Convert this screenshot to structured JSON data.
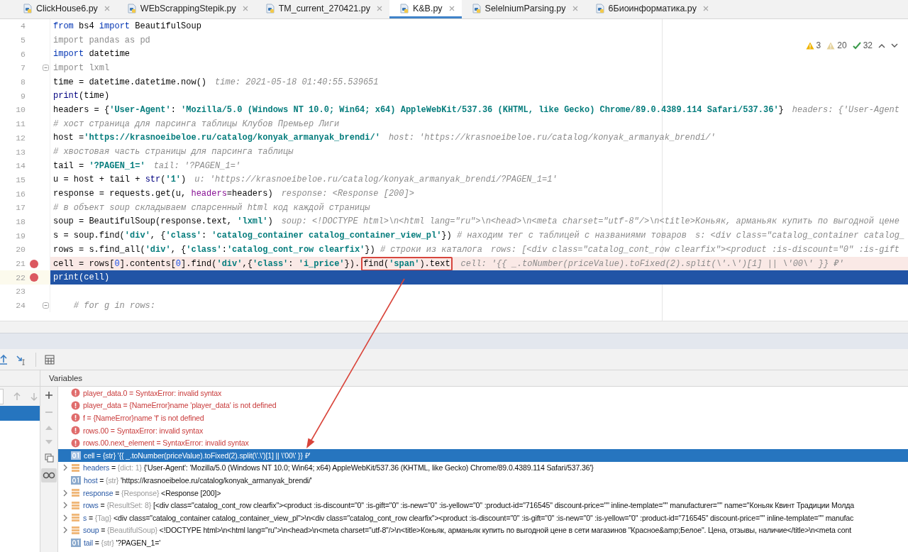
{
  "tabs": [
    {
      "label": "ClickHouse6.py",
      "selected": false
    },
    {
      "label": "WEbScrappingStepik.py",
      "selected": false
    },
    {
      "label": "TM_current_270421.py",
      "selected": false
    },
    {
      "label": "K&B.py",
      "selected": true
    },
    {
      "label": "SelelniumParsing.py",
      "selected": false
    },
    {
      "label": "6Биоинформатика.py",
      "selected": false
    }
  ],
  "inspections": {
    "errors": "3",
    "warnings": "20",
    "passed": "32"
  },
  "editor": {
    "lines": [
      {
        "number": "4",
        "breakpoint": false,
        "kind": "plain",
        "fold": false,
        "tokens": [
          {
            "kind": "keyword",
            "text": "from"
          },
          {
            "kind": "plain",
            "text": " bs4 "
          },
          {
            "kind": "keyword",
            "text": "import"
          },
          {
            "kind": "plain",
            "text": " BeautifulSoup"
          }
        ]
      },
      {
        "number": "5",
        "breakpoint": false,
        "kind": "plain",
        "fold": false,
        "tokens": [
          {
            "kind": "unused",
            "text": "import pandas as pd"
          }
        ]
      },
      {
        "number": "6",
        "breakpoint": false,
        "kind": "plain",
        "fold": false,
        "tokens": [
          {
            "kind": "keyword",
            "text": "import"
          },
          {
            "kind": "plain",
            "text": " datetime"
          }
        ]
      },
      {
        "number": "7",
        "breakpoint": false,
        "kind": "plain",
        "fold": true,
        "tokens": [
          {
            "kind": "unused",
            "text": "import lxml"
          }
        ]
      },
      {
        "number": "8",
        "breakpoint": false,
        "kind": "plain",
        "fold": false,
        "tokens": [
          {
            "kind": "plain",
            "text": "time = datetime.datetime.now()"
          }
        ],
        "hint": "time: 2021-05-18 01:40:55.539651"
      },
      {
        "number": "9",
        "breakpoint": false,
        "kind": "plain",
        "fold": false,
        "tokens": [
          {
            "kind": "builtin",
            "text": "print"
          },
          {
            "kind": "plain",
            "text": "(time)"
          }
        ]
      },
      {
        "number": "10",
        "breakpoint": false,
        "kind": "plain",
        "fold": false,
        "tokens": [
          {
            "kind": "plain",
            "text": "headers = {"
          },
          {
            "kind": "string",
            "text": "'User-Agent'"
          },
          {
            "kind": "plain",
            "text": ": "
          },
          {
            "kind": "string",
            "text": "'Mozilla/5.0 (Windows NT 10.0; Win64; x64) AppleWebKit/537.36 (KHTML, like Gecko) Chrome/89.0.4389.114 Safari/537.36'"
          },
          {
            "kind": "plain",
            "text": "}"
          }
        ],
        "hint": "headers: {'User-Agent"
      },
      {
        "number": "11",
        "breakpoint": false,
        "kind": "plain",
        "fold": false,
        "tokens": [
          {
            "kind": "comment",
            "text": "# хост страница для парсинга таблицы Клубов Премьер Лиги"
          }
        ]
      },
      {
        "number": "12",
        "breakpoint": false,
        "kind": "plain",
        "fold": false,
        "tokens": [
          {
            "kind": "plain",
            "text": "host ="
          },
          {
            "kind": "string",
            "text": "'https://krasnoeibeloe.ru/catalog/konyak_armanyak_brendi/'"
          }
        ],
        "hint": "host: 'https://krasnoeibeloe.ru/catalog/konyak_armanyak_brendi/'"
      },
      {
        "number": "13",
        "breakpoint": false,
        "kind": "plain",
        "fold": false,
        "tokens": [
          {
            "kind": "comment",
            "text": "# хвостовая часть страницы для парсинга таблицы"
          }
        ]
      },
      {
        "number": "14",
        "breakpoint": false,
        "kind": "plain",
        "fold": false,
        "tokens": [
          {
            "kind": "plain",
            "text": "tail = "
          },
          {
            "kind": "string",
            "text": "'?PAGEN_1='"
          }
        ],
        "hint": "tail: '?PAGEN_1='"
      },
      {
        "number": "15",
        "breakpoint": false,
        "kind": "plain",
        "fold": false,
        "tokens": [
          {
            "kind": "plain",
            "text": "u = host + tail + "
          },
          {
            "kind": "builtin",
            "text": "str"
          },
          {
            "kind": "plain",
            "text": "("
          },
          {
            "kind": "string",
            "text": "'1'"
          },
          {
            "kind": "plain",
            "text": ")"
          }
        ],
        "hint": "u: 'https://krasnoeibeloe.ru/catalog/konyak_armanyak_brendi/?PAGEN_1=1'"
      },
      {
        "number": "16",
        "breakpoint": false,
        "kind": "plain",
        "fold": false,
        "tokens": [
          {
            "kind": "plain",
            "text": "response = requests.get(u, "
          },
          {
            "kind": "param",
            "text": "headers"
          },
          {
            "kind": "plain",
            "text": "=headers)"
          }
        ],
        "hint": "response: <Response [200]>"
      },
      {
        "number": "17",
        "breakpoint": false,
        "kind": "plain",
        "fold": false,
        "tokens": [
          {
            "kind": "comment",
            "text": "# в объект soup складываем спарсенный html код каждой страницы"
          }
        ]
      },
      {
        "number": "18",
        "breakpoint": false,
        "kind": "plain",
        "fold": false,
        "tokens": [
          {
            "kind": "plain",
            "text": "soup = BeautifulSoup(response.text, "
          },
          {
            "kind": "string",
            "text": "'lxml'"
          },
          {
            "kind": "plain",
            "text": ")"
          }
        ],
        "hint": "soup: <!DOCTYPE html>\\n<html lang=\"ru\">\\n<head>\\n<meta charset=\"utf-8\"/>\\n<title>Коньяк, арманьяк купить по выгодной цене"
      },
      {
        "number": "19",
        "breakpoint": false,
        "kind": "plain",
        "fold": false,
        "tokens": [
          {
            "kind": "plain",
            "text": "s = soup.find("
          },
          {
            "kind": "string",
            "text": "'div'"
          },
          {
            "kind": "plain",
            "text": ", {"
          },
          {
            "kind": "string",
            "text": "'class'"
          },
          {
            "kind": "plain",
            "text": ": "
          },
          {
            "kind": "string",
            "text": "'catalog_container catalog_container_view_pl'"
          },
          {
            "kind": "plain",
            "text": "}) "
          },
          {
            "kind": "comment",
            "text": "# находим тег с таблицей с названиями товаров"
          }
        ],
        "hint": "s: <div class=\"catalog_container catalog_"
      },
      {
        "number": "20",
        "breakpoint": false,
        "kind": "plain",
        "fold": false,
        "tokens": [
          {
            "kind": "plain",
            "text": "rows = s.find_all("
          },
          {
            "kind": "string",
            "text": "'div'"
          },
          {
            "kind": "plain",
            "text": ", {"
          },
          {
            "kind": "string",
            "text": "'class'"
          },
          {
            "kind": "plain",
            "text": ":"
          },
          {
            "kind": "string",
            "text": "'catalog_cont_row clearfix'"
          },
          {
            "kind": "plain",
            "text": "}) "
          },
          {
            "kind": "comment",
            "text": "# строки из каталога"
          }
        ],
        "hint": "rows: [<div class=\"catalog_cont_row clearfix\"><product :is-discount=\"0\" :is-gift"
      },
      {
        "number": "21",
        "breakpoint": true,
        "kind": "breakpoint",
        "fold": false,
        "tokens": [
          {
            "kind": "plain",
            "text": "cell = rows["
          },
          {
            "kind": "number",
            "text": "0"
          },
          {
            "kind": "plain",
            "text": "].contents["
          },
          {
            "kind": "number",
            "text": "0"
          },
          {
            "kind": "plain",
            "text": "].find("
          },
          {
            "kind": "string",
            "text": "'div'"
          },
          {
            "kind": "plain",
            "text": ",{"
          },
          {
            "kind": "string",
            "text": "'class'"
          },
          {
            "kind": "plain",
            "text": ": "
          },
          {
            "kind": "string",
            "text": "'i_price'"
          },
          {
            "kind": "plain",
            "text": "})."
          },
          {
            "kind": "plain",
            "text": "find(",
            "boxed": true
          },
          {
            "kind": "string",
            "text": "'span'",
            "boxed": true
          },
          {
            "kind": "plain",
            "text": ").text",
            "boxed": true
          }
        ],
        "hint": "cell: '{{ _.toNumber(priceValue).toFixed(2).split(\\'.\\')[1] || \\'00\\' }} ₽'"
      },
      {
        "number": "22",
        "breakpoint": true,
        "kind": "current",
        "fold": false,
        "tokens": [
          {
            "kind": "builtin",
            "text": "print"
          },
          {
            "kind": "plain",
            "text": "(cell)"
          }
        ]
      },
      {
        "number": "23",
        "breakpoint": false,
        "kind": "plain",
        "fold": false
      },
      {
        "number": "24",
        "breakpoint": false,
        "kind": "plain",
        "fold": true,
        "tokens": [
          {
            "kind": "comment",
            "text": "    # for g in rows:"
          }
        ]
      }
    ]
  },
  "debugger": {
    "frames": [
      {
        "selected": true
      }
    ],
    "variables_title": "Variables",
    "variables": [
      {
        "kind": "error",
        "name": "player_data.0",
        "op": "=",
        "value": "SyntaxError: invalid syntax",
        "selected": false
      },
      {
        "kind": "error",
        "name": "player_data",
        "op": "=",
        "type": "{NameError}",
        "value": "name 'player_data' is not defined",
        "selected": false
      },
      {
        "kind": "error",
        "name": "f",
        "op": "=",
        "type": "{NameError}",
        "value": "name 'f' is not defined",
        "selected": false
      },
      {
        "kind": "error",
        "name": "rows.00",
        "op": "=",
        "value": "SyntaxError: invalid syntax",
        "selected": false
      },
      {
        "kind": "error",
        "name": "rows.00.next_element",
        "op": "=",
        "value": "SyntaxError: invalid syntax",
        "selected": false
      },
      {
        "kind": "string",
        "name": "cell",
        "op": "=",
        "type": "{str}",
        "value": "'{{ _.toNumber(priceValue).toFixed(2).split(\\'.\\')[1] || \\'00\\' }} ₽'",
        "selected": true
      },
      {
        "kind": "object",
        "name": "headers",
        "op": "=",
        "type": "{dict: 1}",
        "value": "{'User-Agent': 'Mozilla/5.0 (Windows NT 10.0; Win64; x64) AppleWebKit/537.36 (KHTML, like Gecko) Chrome/89.0.4389.114 Safari/537.36'}",
        "selected": false
      },
      {
        "kind": "string",
        "name": "host",
        "op": "=",
        "type": "{str}",
        "value": "'https://krasnoeibeloe.ru/catalog/konyak_armanyak_brendi/'",
        "selected": false
      },
      {
        "kind": "object",
        "name": "response",
        "op": "=",
        "type": "{Response}",
        "value": "<Response [200]>",
        "selected": false
      },
      {
        "kind": "object",
        "name": "rows",
        "op": "=",
        "type": "{ResultSet: 8}",
        "value": "[<div class=\"catalog_cont_row clearfix\"><product :is-discount=\"0\" :is-gift=\"0\" :is-new=\"0\" :is-yellow=\"0\" :product-id=\"716545\" discount-price=\"\" inline-template=\"\" manufacturer=\"\" name=\"Коньяк Квинт Традиции Молда",
        "selected": false
      },
      {
        "kind": "object",
        "name": "s",
        "op": "=",
        "type": "{Tag}",
        "value": "<div class=\"catalog_container catalog_container_view_pl\">\\n<div class=\"catalog_cont_row clearfix\"><product :is-discount=\"0\" :is-gift=\"0\" :is-new=\"0\" :is-yellow=\"0\" :product-id=\"716545\" discount-price=\"\" inline-template=\"\" manufac",
        "selected": false
      },
      {
        "kind": "object",
        "name": "soup",
        "op": "=",
        "type": "{BeautifulSoup}",
        "value": "<!DOCTYPE html>\\n<html lang=\"ru\">\\n<head>\\n<meta charset=\"utf-8\"/>\\n<title>Коньяк, арманьяк купить по выгодной цене в сети магазинов \"Красное&amp;Белое\". Цена, отзывы, наличие</title>\\n<meta cont",
        "selected": false
      },
      {
        "kind": "string",
        "name": "tail",
        "op": "=",
        "type": "{str}",
        "value": "'?PAGEN_1='",
        "selected": false
      }
    ]
  }
}
